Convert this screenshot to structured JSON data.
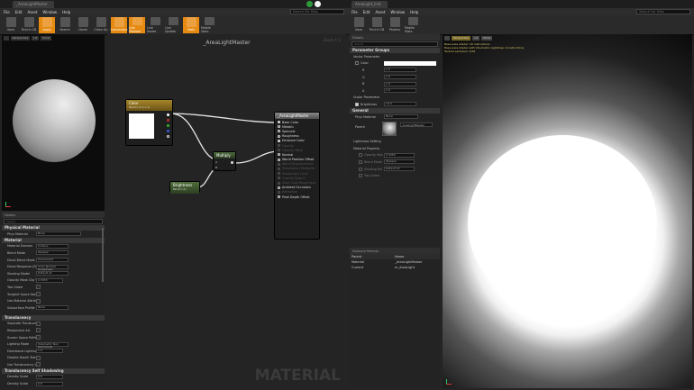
{
  "left_window": {
    "tab_title": "_AreaLightMaster",
    "menu": [
      "File",
      "Edit",
      "Asset",
      "Window",
      "Help"
    ],
    "search_placeholder": "Search For Help",
    "toolbar": [
      {
        "label": "Save",
        "hl": false
      },
      {
        "label": "Find in CB",
        "hl": false
      },
      {
        "label": "Apply",
        "hl": true
      },
      {
        "label": "Search",
        "hl": false
      },
      {
        "label": "Home",
        "hl": false
      },
      {
        "label": "Clean Up",
        "hl": false
      },
      {
        "label": "Connectors",
        "hl": true
      },
      {
        "label": "Live Preview",
        "hl": true
      },
      {
        "label": "Live Nodes",
        "hl": false
      },
      {
        "label": "Live Update",
        "hl": false
      },
      {
        "label": "Stats",
        "hl": true
      },
      {
        "label": "Mobile Stats",
        "hl": false
      }
    ],
    "viewport": {
      "btn1": "Perspective",
      "btn2": "Lit",
      "btn3": "Show"
    },
    "graph": {
      "title": "_AreaLightMaster",
      "zoom": "Zoom 1:1",
      "watermark": "MATERIAL"
    },
    "nodes": {
      "color": {
        "title": "Color",
        "subtitle": "Param (1,1,1,1)"
      },
      "multiply": {
        "title": "Multiply"
      },
      "brightness": {
        "title": "Brightness",
        "subtitle": "Param (1)"
      },
      "master": {
        "title": "_AreaLightMaster",
        "pins": [
          {
            "label": "Base Color",
            "on": true
          },
          {
            "label": "Metallic",
            "on": true
          },
          {
            "label": "Specular",
            "on": true
          },
          {
            "label": "Roughness",
            "on": true
          },
          {
            "label": "Emissive Color",
            "on": true
          },
          {
            "label": "Opacity",
            "on": false
          },
          {
            "label": "Opacity Mask",
            "on": false
          },
          {
            "label": "Normal",
            "on": true
          },
          {
            "label": "World Position Offset",
            "on": true
          },
          {
            "label": "World Displacement",
            "on": false
          },
          {
            "label": "Tessellation Multiplier",
            "on": false
          },
          {
            "label": "Subsurface Color",
            "on": false
          },
          {
            "label": "Custom Data 0",
            "on": false
          },
          {
            "label": "Clear Coat Roughness",
            "on": false
          },
          {
            "label": "Ambient Occlusion",
            "on": true
          },
          {
            "label": "Refraction",
            "on": false
          },
          {
            "label": "Pixel Depth Offset",
            "on": true
          }
        ]
      }
    },
    "details": {
      "tab": "Details",
      "search_placeholder": "Search",
      "physical_material_cat": "Physical Material",
      "phys_material_label": "Phys Material",
      "phys_material_value": "None",
      "material_cat": "Material",
      "rows": [
        {
          "label": "Material Domain",
          "value": "Surface",
          "kind": "drop"
        },
        {
          "label": "Blend Mode",
          "value": "Opaque",
          "kind": "drop"
        },
        {
          "label": "Decal Blend Mode",
          "value": "Translucent",
          "kind": "drop"
        },
        {
          "label": "Decal Response (DBuf",
          "value": "Color Normal Roughness",
          "kind": "drop"
        },
        {
          "label": "Shading Model",
          "value": "Default Lit",
          "kind": "drop"
        },
        {
          "label": "Opacity Mask Clip Val",
          "value": "0.3333",
          "kind": "num"
        },
        {
          "label": "Two Sided",
          "value": "",
          "kind": "chk"
        },
        {
          "label": "Tangent Space Norma",
          "value": "",
          "kind": "chk"
        },
        {
          "label": "Use Material Attribut",
          "value": "",
          "kind": "chk"
        },
        {
          "label": "Subsurface Profile",
          "value": "None",
          "kind": "drop"
        }
      ],
      "translucency_cat": "Translucency",
      "trans_rows": [
        {
          "label": "Separate Translucenc",
          "value": "",
          "kind": "chk"
        },
        {
          "label": "Responsive AA",
          "value": "",
          "kind": "chk"
        },
        {
          "label": "Screen Space Reflecti",
          "value": "",
          "kind": "chk"
        },
        {
          "label": "Lighting Mode",
          "value": "Volumetric Non Directional",
          "kind": "drop"
        },
        {
          "label": "Directional Lighting In",
          "value": "1.0",
          "kind": "num"
        },
        {
          "label": "Disable Depth Test",
          "value": "",
          "kind": "chk"
        },
        {
          "label": "Use Translucency Ver",
          "value": "",
          "kind": "chk"
        }
      ],
      "self_shadow_cat": "Translucency Self Shadowing",
      "shadow_rows": [
        {
          "label": "Density Scale",
          "value": "0.5",
          "kind": "num"
        },
        {
          "label": "Density Scale",
          "value": "0.5",
          "kind": "num"
        }
      ]
    }
  },
  "right_window": {
    "tab_title": "AreaLight_Inst",
    "menu": [
      "File",
      "Edit",
      "Asset",
      "Window",
      "Help"
    ],
    "search_placeholder": "Search For Help",
    "toolbar": [
      {
        "label": "Save"
      },
      {
        "label": "Find in CB"
      },
      {
        "label": "Params"
      },
      {
        "label": "Mobile Stats"
      }
    ],
    "details": {
      "tab": "Details",
      "search_placeholder": "Search",
      "param_groups": "Parameter Groups",
      "vector_params": "Vector Parameter",
      "color_label": "Color",
      "r_label": "R",
      "r": "1.0",
      "g_label": "G",
      "g": "1.0",
      "b_label": "B",
      "b": "1.0",
      "a_label": "A",
      "a": "1.0",
      "scalar_params": "Scalar Parameter",
      "brightness_label": "Brightness",
      "brightness": "10.0",
      "general_cat": "General",
      "phys_material_label": "Phys Material",
      "phys_material_value": "None",
      "parent_label": "Parent",
      "parent_value": "_AreaLightMaster",
      "lightmass": "Lightmass Setting",
      "material_property": "Material Property",
      "mp_rows": [
        {
          "label": "Opacity Mas",
          "value": "0.3333"
        },
        {
          "label": "Blend Mode",
          "value": "Opaque"
        },
        {
          "label": "Shading Mo",
          "value": "Default Lit"
        },
        {
          "label": "Two Sided",
          "value": ""
        }
      ]
    },
    "instance_parents": {
      "tab": "Instance Parents",
      "col1": "Parent",
      "col2": "Name",
      "rows": [
        {
          "c1": "Material",
          "c2": "_AreaLightMaster"
        },
        {
          "c1": "Current",
          "c2": "m_AreaLight"
        }
      ]
    },
    "viewport": {
      "btn1": "Perspective",
      "btn2": "Lit",
      "btn3": "Show",
      "stats": [
        "Base pass shader: 20 instructions",
        "Base pass shader with Volumetric Lightmap: 0 instructions",
        "Texture samplers: 0/16"
      ]
    }
  }
}
